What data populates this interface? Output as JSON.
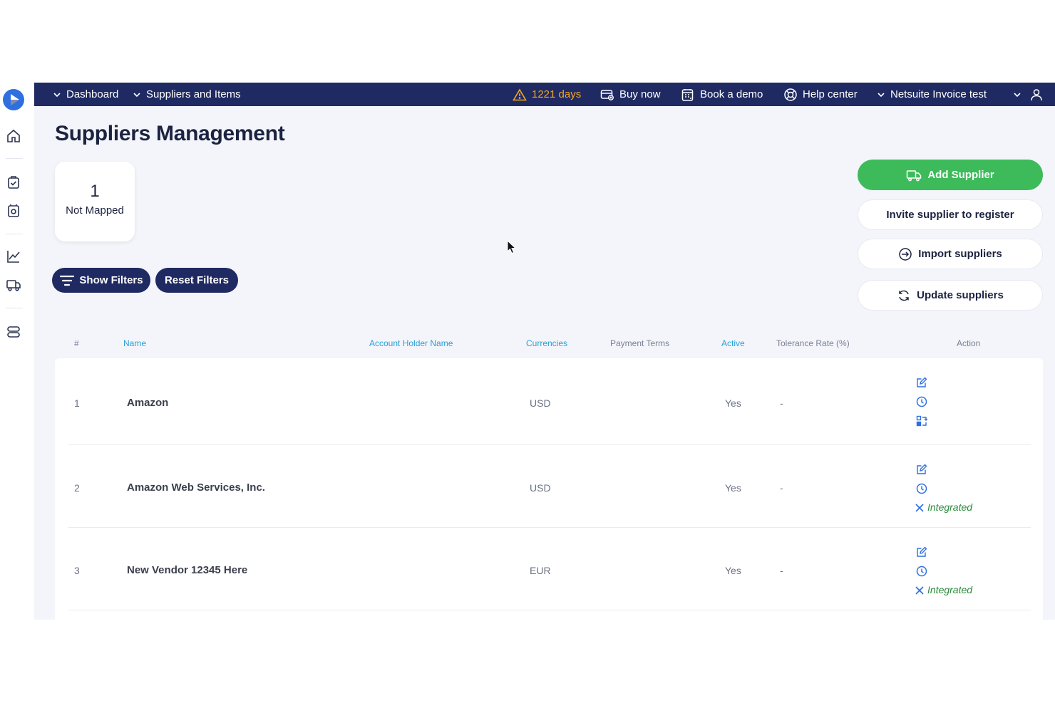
{
  "topbar": {
    "dashboard": "Dashboard",
    "suppliers_items": "Suppliers and Items",
    "trial_warning": "1221 days",
    "buy_now": "Buy now",
    "book_demo": "Book a demo",
    "help_center": "Help center",
    "company": "Netsuite Invoice test"
  },
  "page": {
    "title": "Suppliers Management"
  },
  "stats": {
    "not_mapped_count": "1",
    "not_mapped_label": "Not Mapped"
  },
  "filters": {
    "show": "Show Filters",
    "reset": "Reset Filters"
  },
  "actions": {
    "add_supplier": "Add Supplier",
    "invite_supplier": "Invite supplier to register",
    "import_suppliers": "Import suppliers",
    "update_suppliers": "Update suppliers"
  },
  "table": {
    "headers": {
      "index": "#",
      "name": "Name",
      "account_holder": "Account Holder Name",
      "currencies": "Currencies",
      "payment_terms": "Payment Terms",
      "active": "Active",
      "tolerance": "Tolerance Rate (%)",
      "action": "Action"
    },
    "rows": [
      {
        "index": "1",
        "name": "Amazon",
        "account_holder": "",
        "currency": "USD",
        "payment_terms": "",
        "active": "Yes",
        "tolerance": "-",
        "status": ""
      },
      {
        "index": "2",
        "name": "Amazon Web Services, Inc.",
        "account_holder": "",
        "currency": "USD",
        "payment_terms": "",
        "active": "Yes",
        "tolerance": "-",
        "status": "Integrated"
      },
      {
        "index": "3",
        "name": "New Vendor 12345 Here",
        "account_holder": "",
        "currency": "EUR",
        "payment_terms": "",
        "active": "Yes",
        "tolerance": "-",
        "status": "Integrated"
      }
    ]
  },
  "colors": {
    "navbar": "#1f2a63",
    "accent_green": "#3dbb5b",
    "link_blue": "#2a9fd6",
    "icon_blue": "#2f6fe0",
    "warning": "#f5a623",
    "integrated_green": "#2a8a3a"
  }
}
